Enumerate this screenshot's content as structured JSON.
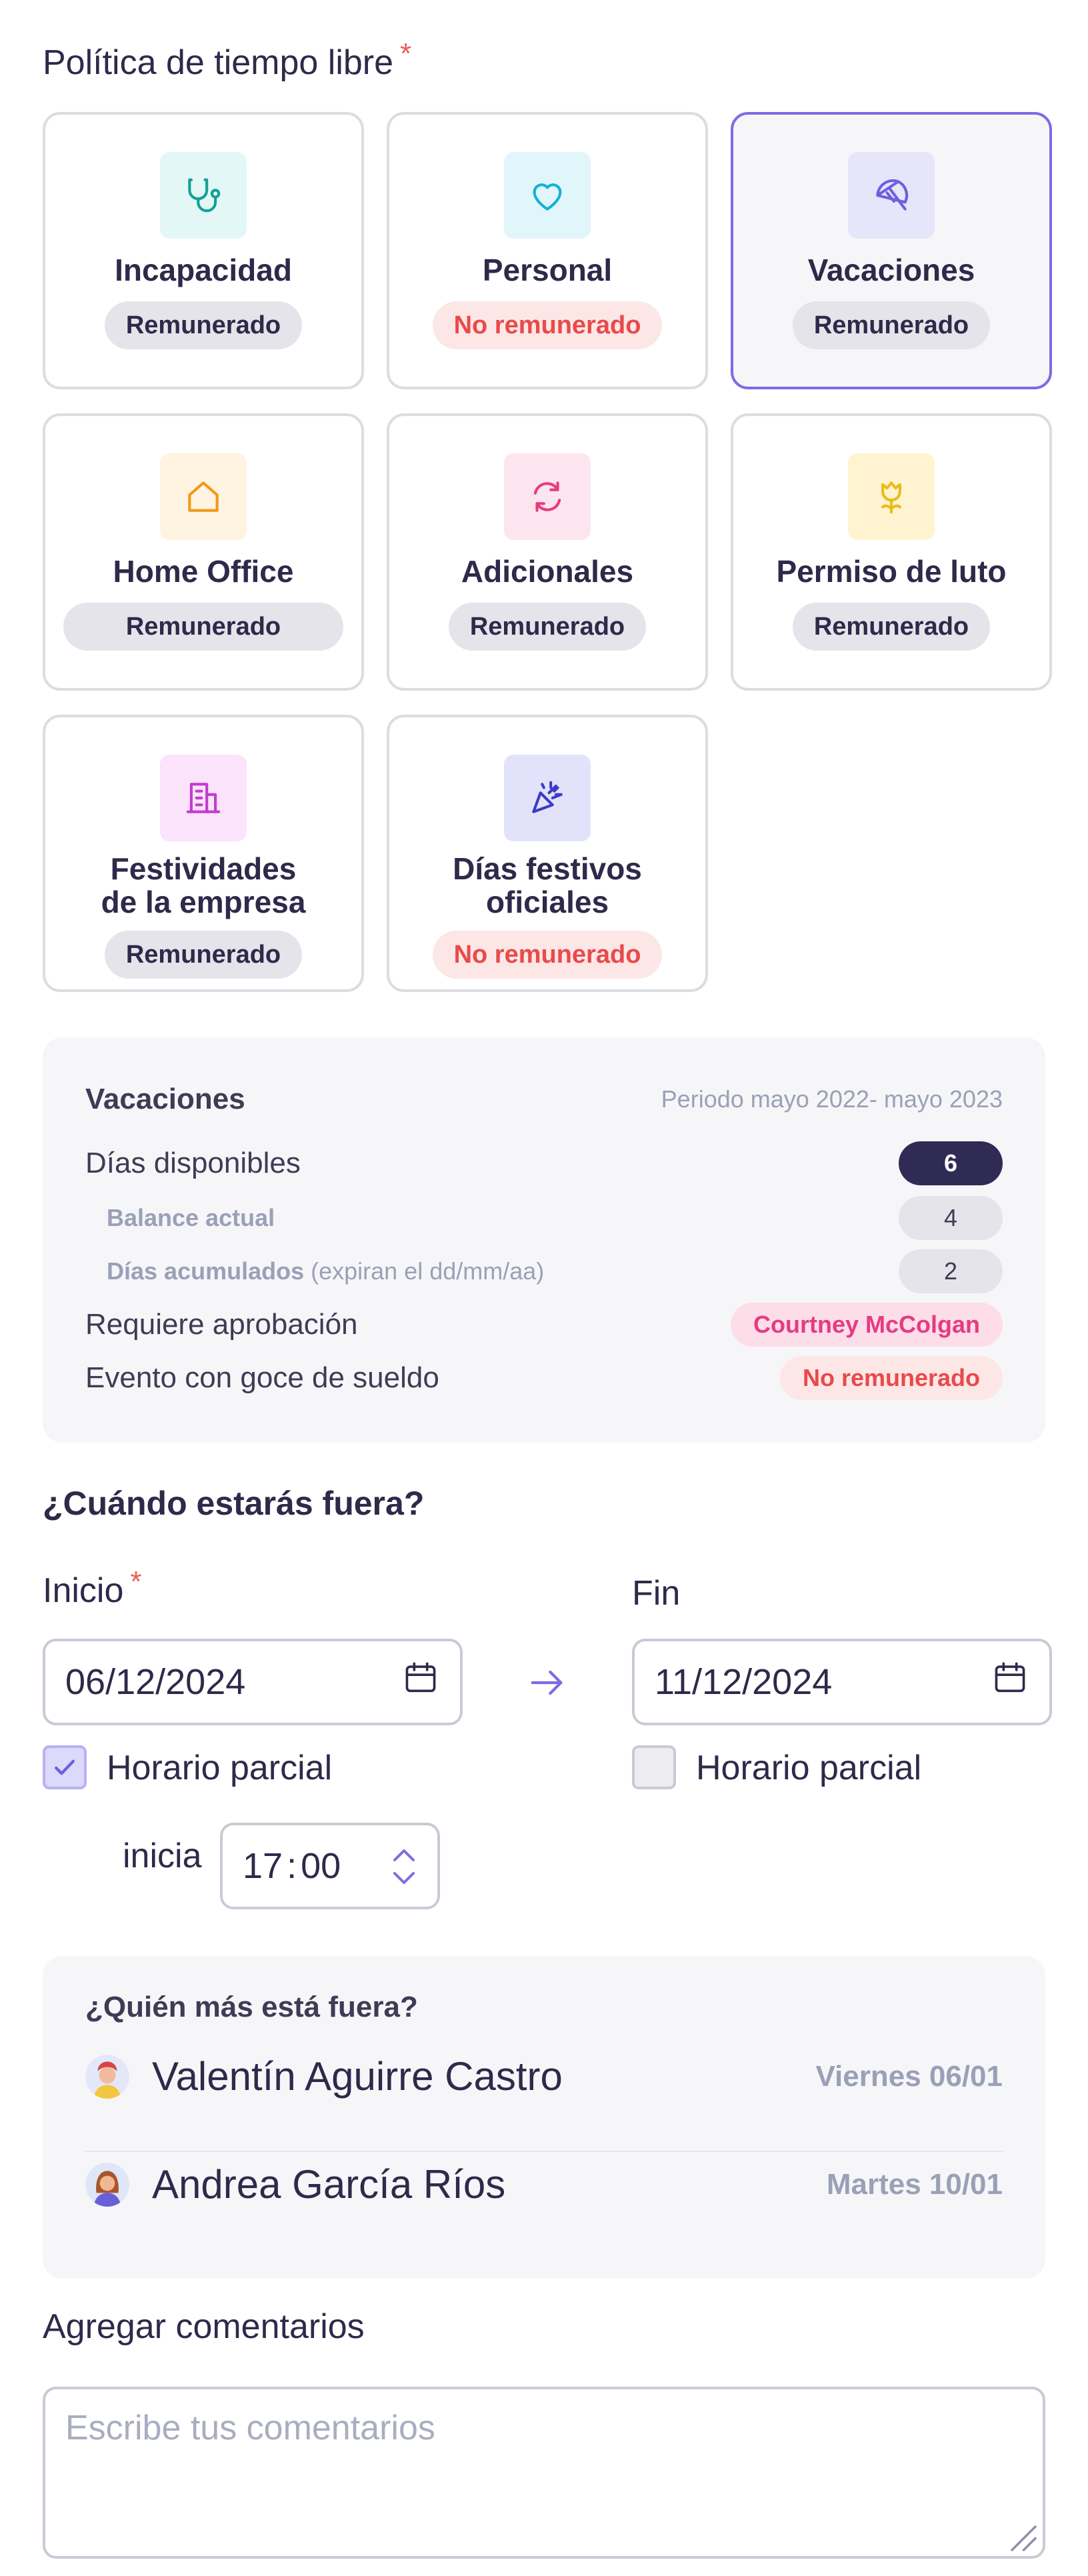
{
  "policy": {
    "title": "Política de tiempo libre",
    "required_mark": "*",
    "cards": [
      {
        "name": "Incapacidad",
        "status": "Remunerado",
        "icon": "stethoscope-icon",
        "icon_bg": "#e3f8f6",
        "icon_color": "#14a196"
      },
      {
        "name": "Personal",
        "status": "No remunerado",
        "icon": "heart-icon",
        "icon_bg": "#e1f6fb",
        "icon_color": "#16b1d4"
      },
      {
        "name": "Vacaciones",
        "status": "Remunerado",
        "icon": "umbrella-icon",
        "icon_bg": "#e7e5fa",
        "icon_color": "#6e5fe0",
        "selected": true
      },
      {
        "name": "Home Office",
        "status": "Remunerado",
        "icon": "house-icon",
        "icon_bg": "#fff3e1",
        "icon_color": "#ef9a18"
      },
      {
        "name": "Adicionales",
        "status": "Remunerado",
        "icon": "refresh-icon",
        "icon_bg": "#fde5ef",
        "icon_color": "#e53b82"
      },
      {
        "name": "Permiso de luto",
        "status": "Remunerado",
        "icon": "flower-icon",
        "icon_bg": "#fff4cf",
        "icon_color": "#e9bc1d"
      },
      {
        "name_l1": "Festividades",
        "name_l2": "de la empresa",
        "status": "Remunerado",
        "icon": "building-icon",
        "icon_bg": "#fbe3fb",
        "icon_color": "#c23dce"
      },
      {
        "name_l1": "Días festivos",
        "name_l2": "oficiales",
        "status": "No remunerado",
        "icon": "party-popper-icon",
        "icon_bg": "#e2e3fb",
        "icon_color": "#3d3bc9"
      }
    ]
  },
  "summary": {
    "title": "Vacaciones",
    "period": "Periodo mayo 2022- mayo 2023",
    "available_label": "Días disponibles",
    "available_value": "6",
    "balance_label": "Balance actual",
    "balance_value": "4",
    "accumulated_label": "Días acumulados",
    "accumulated_note": " (expiran el dd/mm/aa)",
    "accumulated_value": "2",
    "approval_label": "Requiere aprobación",
    "approver": "Courtney McColgan",
    "paid_label": "Evento con goce de sueldo",
    "paid_value": "No remunerado"
  },
  "when": {
    "title": "¿Cuándo estarás fuera?",
    "start_label": "Inicio",
    "required_mark": "*",
    "end_label": "Fin",
    "start_date": "06/12/2024",
    "end_date": "11/12/2024",
    "partial_label": "Horario parcial",
    "start_partial_checked": true,
    "end_partial_checked": false,
    "starts_label": "inicia",
    "start_hour": "17",
    "time_sep": ":",
    "start_min": "00"
  },
  "who_out": {
    "title": "¿Quién más está fuera?",
    "people": [
      {
        "name": "Valentín Aguirre Castro",
        "date": "Viernes 06/01"
      },
      {
        "name": "Andrea García Ríos",
        "date": "Martes 10/01"
      }
    ]
  },
  "comments": {
    "label": "Agregar comentarios",
    "placeholder": "Escribe tus comentarios"
  },
  "colors": {
    "accent": "#7c6ce4",
    "dark_pill": "#302b55",
    "required": "#ee5b5b"
  }
}
